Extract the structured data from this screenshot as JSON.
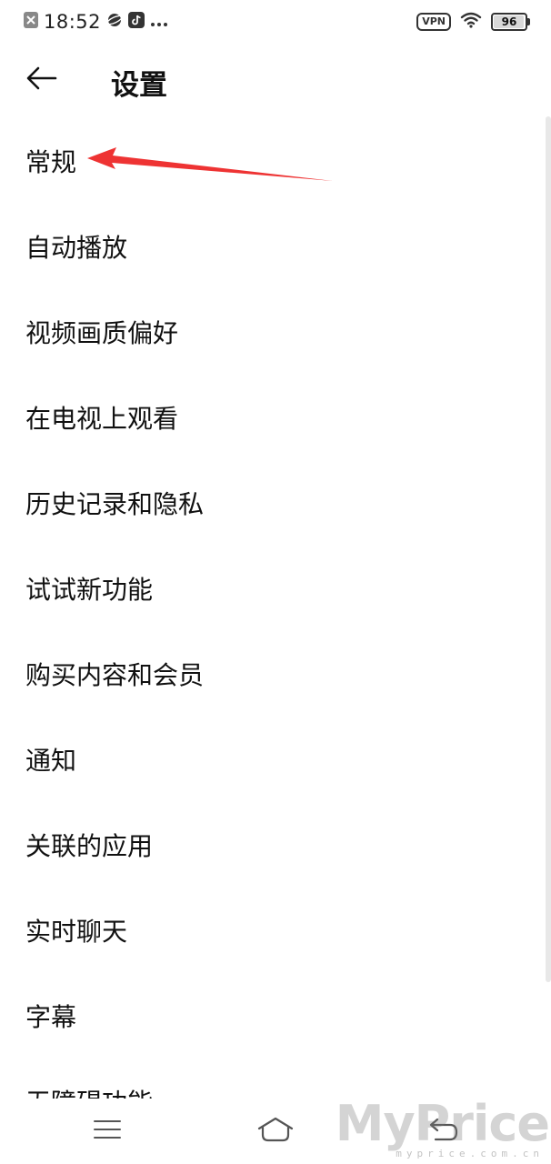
{
  "status_bar": {
    "time": "18:52",
    "vpn": "VPN",
    "battery": 96,
    "battery_label": "96",
    "icons": [
      "close-notification-icon",
      "planet-app-icon",
      "tiktok-icon",
      "more-dots-icon",
      "vpn-icon",
      "wifi-icon",
      "battery-icon"
    ]
  },
  "header": {
    "back_icon": "arrow-left-icon",
    "title": "设置"
  },
  "settings": {
    "items": [
      {
        "label": "常规"
      },
      {
        "label": "自动播放"
      },
      {
        "label": "视频画质偏好"
      },
      {
        "label": "在电视上观看"
      },
      {
        "label": "历史记录和隐私"
      },
      {
        "label": "试试新功能"
      },
      {
        "label": "购买内容和会员"
      },
      {
        "label": "通知"
      },
      {
        "label": "关联的应用"
      },
      {
        "label": "实时聊天"
      },
      {
        "label": "字幕"
      },
      {
        "label": "无障碍功能"
      }
    ]
  },
  "annotation": {
    "color": "#ee3333",
    "target": "常规"
  },
  "nav_bar": {
    "icons": [
      "menu-icon",
      "home-icon",
      "back-return-icon"
    ]
  },
  "watermark": {
    "main": "MyPrice",
    "sub": "myprice.com.cn"
  }
}
